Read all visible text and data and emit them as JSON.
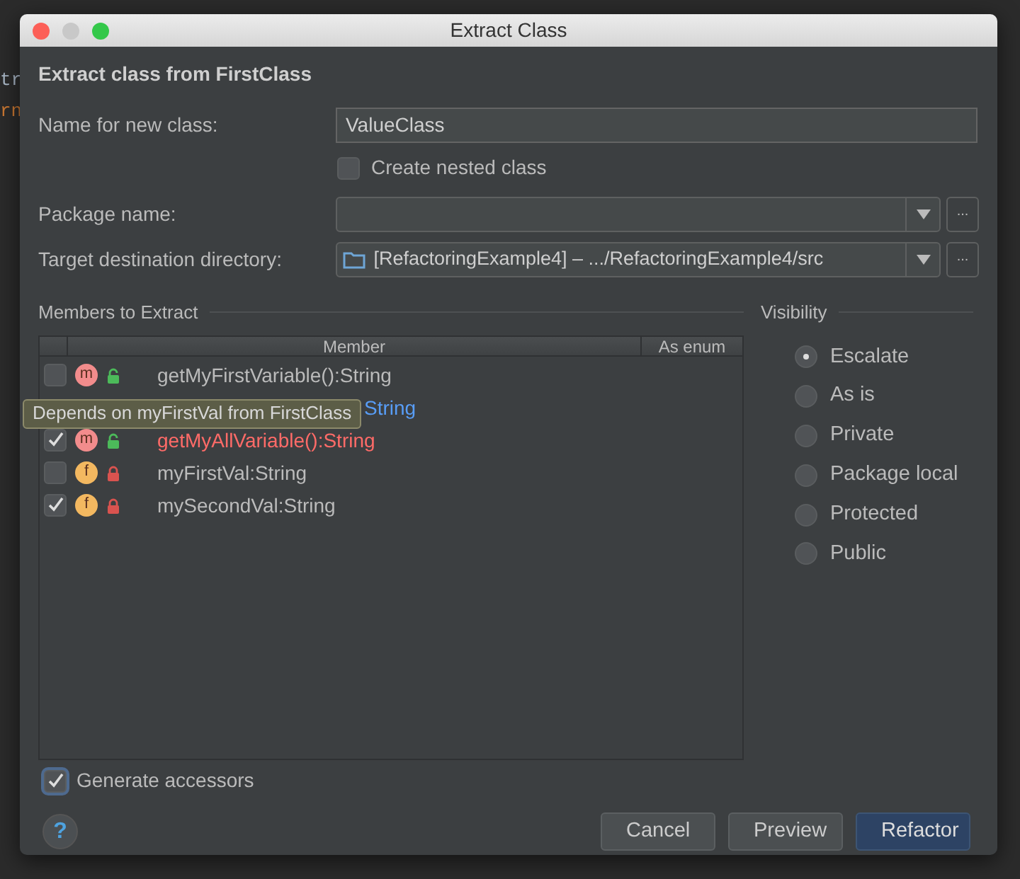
{
  "editor": {
    "side_lines": [
      "tr",
      "rn"
    ]
  },
  "window": {
    "title": "Extract Class"
  },
  "heading": "Extract class from FirstClass",
  "name_field": {
    "label": "Name for new class:",
    "value": "ValueClass"
  },
  "nested_checkbox": {
    "label": "Create nested class",
    "checked": false
  },
  "package_field": {
    "label": "Package name:",
    "browse": "..."
  },
  "target_field": {
    "label": "Target destination directory:",
    "value": "[RefactoringExample4] – .../RefactoringExample4/src",
    "browse": "..."
  },
  "members": {
    "title": "Members to Extract",
    "columns": [
      "Member",
      "As enum"
    ],
    "rows": [
      {
        "kind": "full",
        "checked": false,
        "badge": "m",
        "locked": false,
        "text": "getMyFirstVariable():String",
        "color": "#bbbbbb"
      },
      {
        "kind": "covered",
        "text": "String",
        "color": "#589df6"
      },
      {
        "kind": "full",
        "checked": true,
        "badge": "m",
        "locked": false,
        "text": "getMyAllVariable():String",
        "color": "#ff6b68"
      },
      {
        "kind": "full",
        "checked": false,
        "badge": "f",
        "locked": true,
        "text": "myFirstVal:String",
        "color": "#bbbbbb"
      },
      {
        "kind": "full",
        "checked": true,
        "badge": "f",
        "locked": true,
        "text": "mySecondVal:String",
        "color": "#bbbbbb"
      }
    ],
    "tooltip": "Depends on myFirstVal from FirstClass"
  },
  "visibility": {
    "title": "Visibility",
    "options": [
      {
        "label": "Escalate",
        "selected": true
      },
      {
        "label": "As is",
        "selected": false
      },
      {
        "label": "Private",
        "selected": false
      },
      {
        "label": "Package local",
        "selected": false
      },
      {
        "label": "Protected",
        "selected": false
      },
      {
        "label": "Public",
        "selected": false
      }
    ]
  },
  "generate_accessors": {
    "label": "Generate accessors",
    "checked": true
  },
  "help": "?",
  "buttons": [
    {
      "label": "Cancel",
      "kind": "normal"
    },
    {
      "label": "Preview",
      "kind": "normal"
    },
    {
      "label": "Refactor",
      "kind": "default"
    }
  ]
}
